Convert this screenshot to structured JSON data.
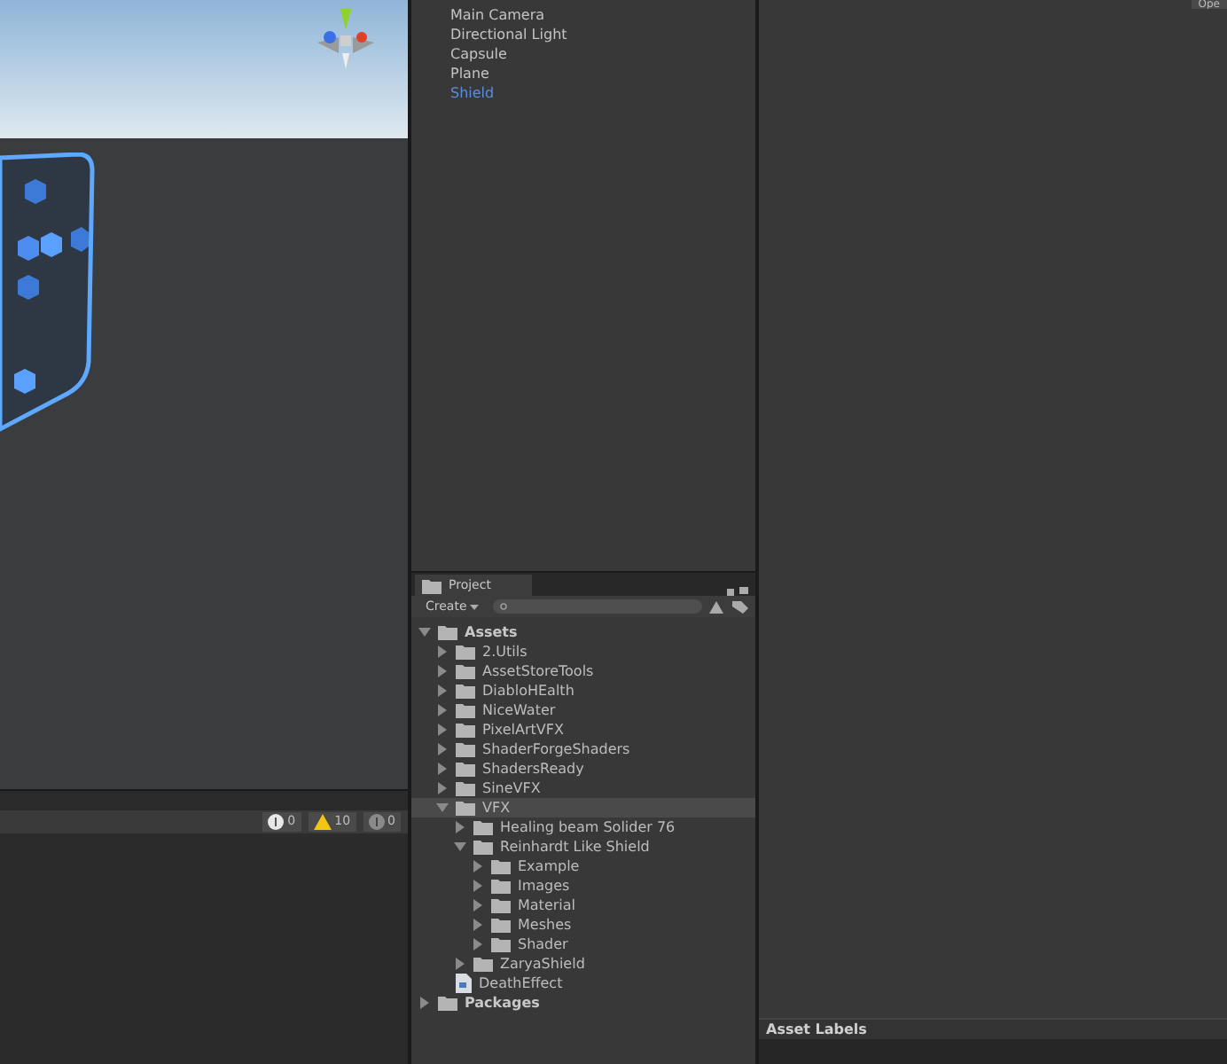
{
  "hierarchy": {
    "items": [
      {
        "label": "Main Camera",
        "selected": false
      },
      {
        "label": "Directional Light",
        "selected": false
      },
      {
        "label": "Capsule",
        "selected": false
      },
      {
        "label": "Plane",
        "selected": false
      },
      {
        "label": "Shield",
        "selected": true
      }
    ]
  },
  "inspector": {
    "top_button": "Ope",
    "asset_labels": "Asset Labels"
  },
  "console": {
    "counts": [
      {
        "kind": "info",
        "text": "0"
      },
      {
        "kind": "warning",
        "text": "10"
      },
      {
        "kind": "error",
        "text": "0"
      }
    ]
  },
  "project": {
    "tab": "Project",
    "create": "Create",
    "tree": [
      {
        "label": "Assets",
        "kind": "root",
        "expanded": true,
        "selected": false,
        "children": [
          {
            "label": "2.Utils",
            "kind": "folder",
            "expanded": false,
            "selected": false
          },
          {
            "label": "AssetStoreTools",
            "kind": "folder",
            "expanded": false,
            "selected": false
          },
          {
            "label": "DiabloHEalth",
            "kind": "folder",
            "expanded": false,
            "selected": false
          },
          {
            "label": "NiceWater",
            "kind": "folder",
            "expanded": false,
            "selected": false
          },
          {
            "label": "PixelArtVFX",
            "kind": "folder",
            "expanded": false,
            "selected": false
          },
          {
            "label": "ShaderForgeShaders",
            "kind": "folder",
            "expanded": false,
            "selected": false
          },
          {
            "label": "ShadersReady",
            "kind": "folder",
            "expanded": false,
            "selected": false
          },
          {
            "label": "SineVFX",
            "kind": "folder",
            "expanded": false,
            "selected": false
          },
          {
            "label": "VFX",
            "kind": "folder",
            "expanded": true,
            "selected": true,
            "children": [
              {
                "label": "Healing beam Solider 76",
                "kind": "folder",
                "expanded": false,
                "selected": false
              },
              {
                "label": "Reinhardt Like Shield",
                "kind": "folder",
                "expanded": true,
                "selected": false,
                "children": [
                  {
                    "label": "Example",
                    "kind": "folder",
                    "expanded": false,
                    "selected": false
                  },
                  {
                    "label": "Images",
                    "kind": "folder",
                    "expanded": false,
                    "selected": false
                  },
                  {
                    "label": "Material",
                    "kind": "folder",
                    "expanded": false,
                    "selected": false
                  },
                  {
                    "label": "Meshes",
                    "kind": "folder",
                    "expanded": false,
                    "selected": false
                  },
                  {
                    "label": "Shader",
                    "kind": "folder",
                    "expanded": false,
                    "selected": false
                  }
                ]
              },
              {
                "label": "ZaryaShield",
                "kind": "folder",
                "expanded": false,
                "selected": false
              }
            ]
          },
          {
            "label": "DeathEffect",
            "kind": "file",
            "selected": false
          }
        ]
      },
      {
        "label": "Packages",
        "kind": "root",
        "expanded": false,
        "selected": false
      }
    ]
  }
}
